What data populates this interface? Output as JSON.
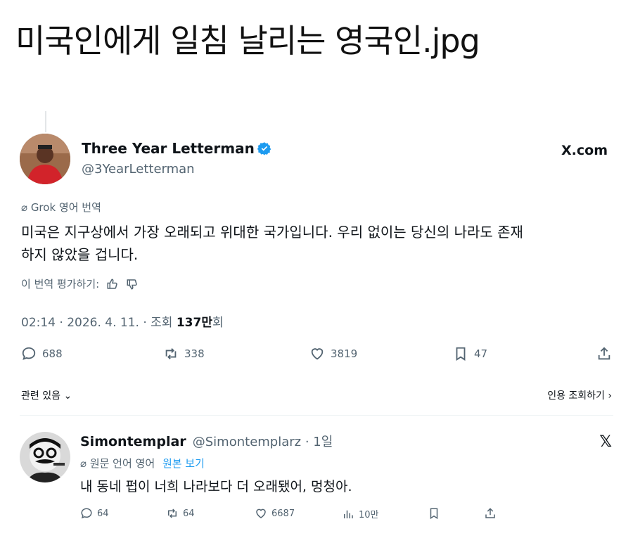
{
  "post_title": "미국인에게 일침 날리는 영국인.jpg",
  "tweet": {
    "display_name": "Three Year Letterman",
    "handle": "@3YearLetterman",
    "source": "X.com",
    "grok_label": "Grok 영어 번역",
    "text_line1": "미국은 지구상에서 가장 오래되고 위대한 국가입니다. 우리 없이는 당신의 나라도 존재",
    "text_line2": "하지 않았을 겁니다.",
    "rate_label": "이 번역 평가하기:",
    "meta_prefix": "02:14 · 2026. 4. 11. · 조회 ",
    "views": "137만",
    "views_suffix": "회",
    "actions": {
      "replies": "688",
      "retweets": "338",
      "likes": "3819",
      "bookmarks": "47"
    },
    "related_label": "관련 있음",
    "quote_label": "인용 조회하기"
  },
  "reply": {
    "display_name": "Simontemplar",
    "handle_time": "@Simontemplarz · 1일",
    "lang_label": "원문 언어 영어",
    "show_original": "원본 보기",
    "text": "내 동네 펍이 너희 나라보다 더 오래됐어, 멍청아.",
    "actions": {
      "replies": "64",
      "retweets": "64",
      "likes": "6687",
      "views": "10만"
    }
  },
  "icons": [
    "verified-icon",
    "x-logo-icon",
    "grok-icon",
    "thumbs-up-icon",
    "thumbs-down-icon",
    "reply-icon",
    "retweet-icon",
    "like-icon",
    "bookmark-icon",
    "share-icon",
    "views-icon",
    "chevron-down-icon",
    "chevron-right-icon"
  ],
  "colors": {
    "verified": "#1d9bf0",
    "link": "#1d9bf0",
    "muted": "#536471",
    "text": "#0f1419"
  }
}
